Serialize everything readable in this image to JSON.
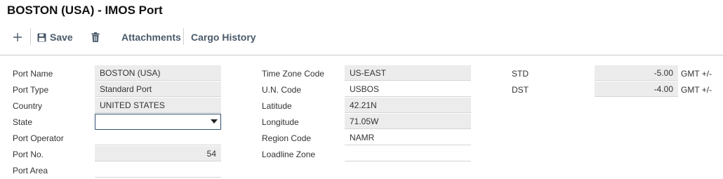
{
  "page": {
    "title": "BOSTON (USA) - IMOS Port"
  },
  "toolbar": {
    "save_label": "Save",
    "attachments_label": "Attachments",
    "cargo_history_label": "Cargo History"
  },
  "icons": {
    "add": "plus-icon",
    "save": "floppy-disk-icon",
    "delete": "trash-icon"
  },
  "colors": {
    "toolbar_text": "#4a5a6a",
    "readonly_field_bg": "#ececec",
    "focused_border": "#2f4f6f"
  },
  "form": {
    "port_name": {
      "label": "Port Name",
      "value": "BOSTON (USA)"
    },
    "port_type": {
      "label": "Port Type",
      "value": "Standard Port"
    },
    "country": {
      "label": "Country",
      "value": "UNITED STATES"
    },
    "state": {
      "label": "State",
      "value": ""
    },
    "port_operator": {
      "label": "Port Operator",
      "value": ""
    },
    "port_no": {
      "label": "Port No.",
      "value": "54"
    },
    "port_area": {
      "label": "Port Area",
      "value": ""
    },
    "time_zone_code": {
      "label": "Time Zone Code",
      "value": "US-EAST"
    },
    "un_code": {
      "label": "U.N. Code",
      "value": "USBOS"
    },
    "latitude": {
      "label": "Latitude",
      "value": "42.21N"
    },
    "longitude": {
      "label": "Longitude",
      "value": "71.05W"
    },
    "region_code": {
      "label": "Region Code",
      "value": "NAMR"
    },
    "loadline_zone": {
      "label": "Loadline Zone",
      "value": ""
    },
    "std": {
      "label": "STD",
      "value": "-5.00",
      "unit": "GMT +/-"
    },
    "dst": {
      "label": "DST",
      "value": "-4.00",
      "unit": "GMT +/-"
    }
  }
}
